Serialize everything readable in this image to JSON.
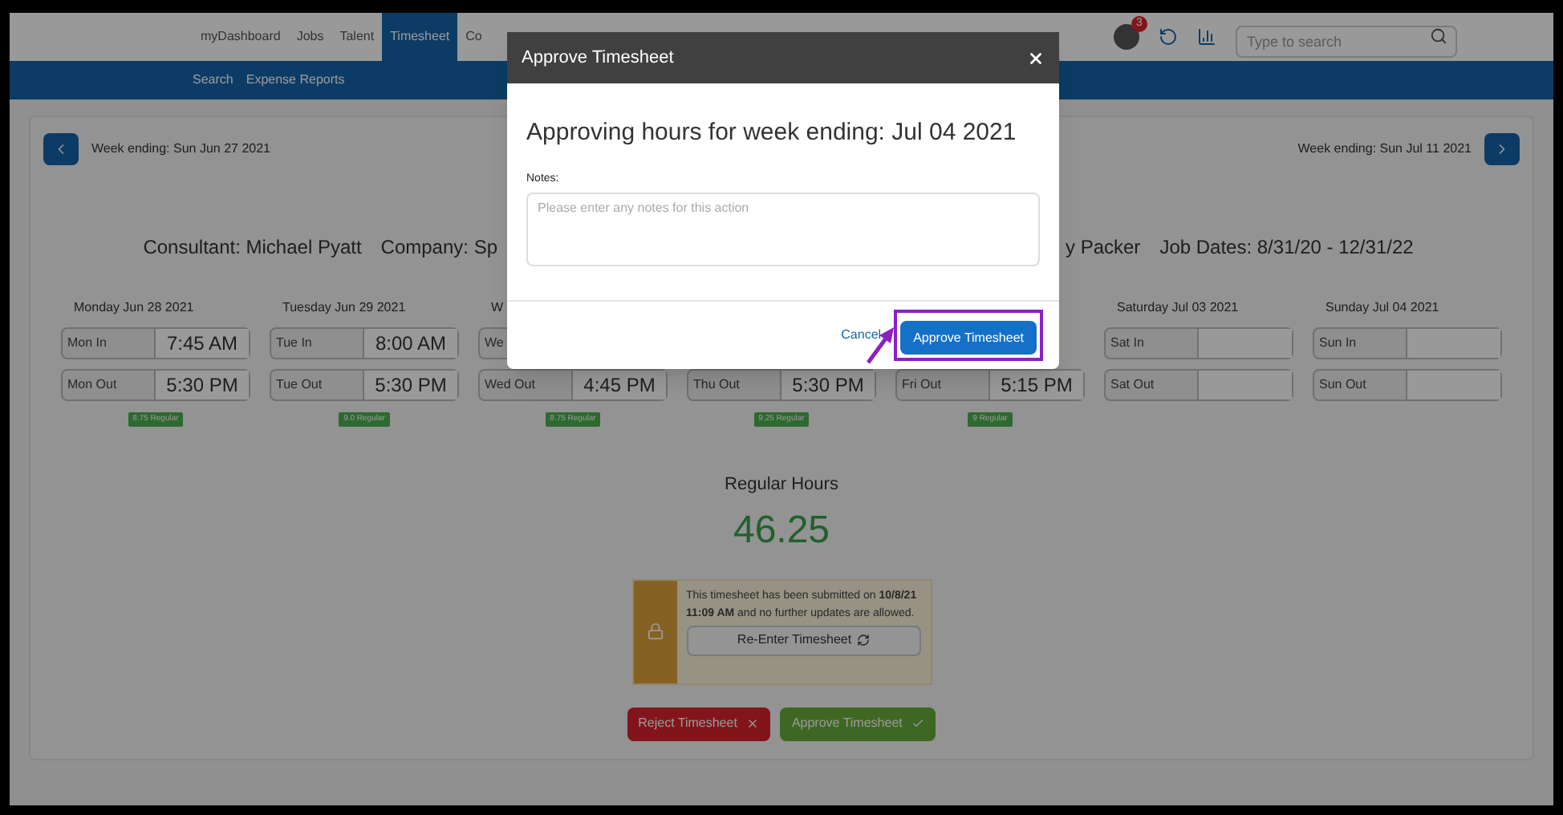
{
  "nav": {
    "tabs": [
      {
        "label": "myDashboard",
        "selected": false
      },
      {
        "label": "Jobs",
        "selected": false
      },
      {
        "label": "Talent",
        "selected": false
      },
      {
        "label": "Timesheet",
        "selected": true
      },
      {
        "label": "Co",
        "selected": false
      }
    ],
    "badge": "3",
    "search": {
      "placeholder": "Type to search"
    }
  },
  "subnav": [
    "Search",
    "Expense Reports"
  ],
  "week": {
    "prev": "Week ending: Sun Jun 27 2021",
    "next": "Week ending: Sun Jul 11 2021"
  },
  "info": [
    "Consultant: Michael Pyatt",
    "Company: Sp",
    "y Packer",
    "Job Dates: 8/31/20 - 12/31/22"
  ],
  "days": [
    {
      "header": "Monday Jun 28 2021",
      "in_label": "Mon In",
      "in_time": "7:45 AM",
      "out_label": "Mon Out",
      "out_time": "5:30 PM",
      "badge": "8.75 Regular"
    },
    {
      "header": "Tuesday Jun 29 2021",
      "in_label": "Tue In",
      "in_time": "8:00 AM",
      "out_label": "Tue Out",
      "out_time": "5:30 PM",
      "badge": "9.0 Regular"
    },
    {
      "header": "W",
      "in_label": "We",
      "out_label": "Wed Out",
      "out_time": "4:45 PM",
      "badge": "8.75 Regular"
    },
    {
      "out_label": "Thu Out",
      "out_time": "5:30 PM",
      "badge": "9.25 Regular"
    },
    {
      "out_label": "Fri Out",
      "out_time": "5:15 PM",
      "badge": "9 Regular"
    },
    {
      "header": "Saturday Jul 03 2021",
      "in_label": "Sat In",
      "out_label": "Sat Out"
    },
    {
      "header": "Sunday Jul 04 2021",
      "in_label": "Sun In",
      "out_label": "Sun Out"
    }
  ],
  "summary": {
    "label": "Regular Hours",
    "value": "46.25"
  },
  "lock": {
    "message": "This timesheet has been submitted on **10/8/21 11:09 AM** and no further updates are allowed.",
    "button": "Re-Enter Timesheet"
  },
  "actions": [
    {
      "label": "Reject Timesheet",
      "kind": "reject"
    },
    {
      "label": "Approve Timesheet",
      "kind": "approve"
    }
  ],
  "modal": {
    "title": "Approve Timesheet",
    "heading": "Approving hours for week ending: Jul 04 2021",
    "notes_label": "Notes:",
    "notes_placeholder": "Please enter any notes for this action",
    "cancel": "Cancel",
    "confirm": "Approve Timesheet"
  }
}
